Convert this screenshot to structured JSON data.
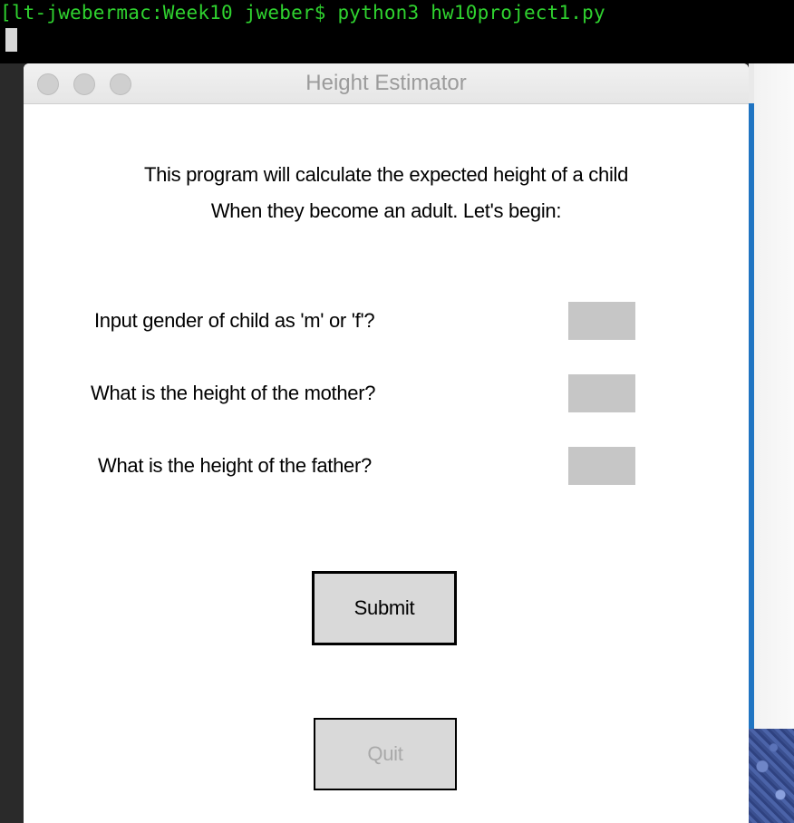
{
  "terminal": {
    "prompt_line": "[lt-jwebermac:Week10 jweber$ python3 hw10project1.py"
  },
  "window": {
    "title": "Height Estimator"
  },
  "intro": {
    "line1": "This program will calculate the expected height of a child",
    "line2": "When they become an adult. Let's begin:"
  },
  "form": {
    "questions": [
      {
        "label": "Input gender of child as 'm' or 'f'?",
        "value": ""
      },
      {
        "label": "What is the height of the mother?",
        "value": ""
      },
      {
        "label": "What is the height of the father?",
        "value": ""
      }
    ]
  },
  "buttons": {
    "submit": "Submit",
    "quit": "Quit"
  },
  "colors": {
    "terminal_text": "#2fd22f",
    "entry_bg": "#c6c6c6",
    "button_bg": "#d9d9d9",
    "quit_text": "#a9a9a9",
    "accent_edge": "#1f74c2"
  }
}
